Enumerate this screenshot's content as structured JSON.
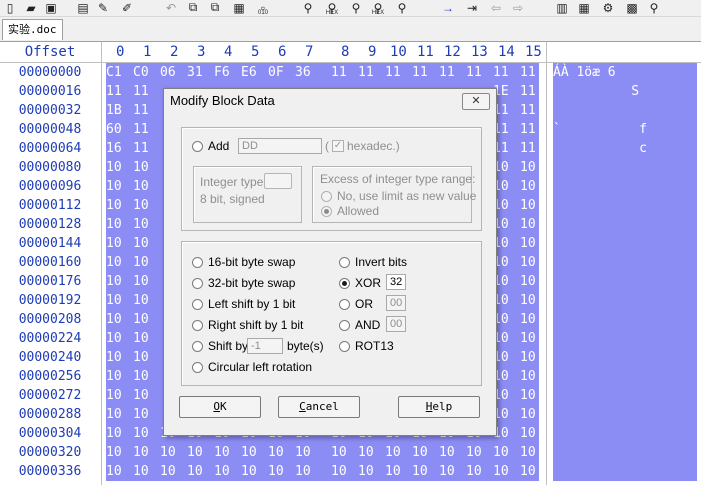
{
  "toolbar": {
    "icons": [
      "new-file-icon",
      "open-icon",
      "save-icon",
      "properties-icon",
      "edit-icon",
      "undo-icon",
      "copy-icon",
      "copy-block-icon",
      "paste-icon",
      "zero-one-icon",
      "find-icon",
      "find-hex-icon",
      "replace-hex-icon",
      "find-next-icon",
      "goto-icon",
      "goto-offset-icon",
      "back-icon",
      "forward-icon",
      "disk-icon",
      "ram-icon",
      "tools-icon",
      "calculator-icon",
      "magnifier-icon"
    ],
    "hex_glyph_labels": [
      "HEX",
      "HEX"
    ],
    "binary_glyph_label": "010"
  },
  "tab": {
    "label": "实验.doc"
  },
  "editor": {
    "offset_header": "Offset",
    "column_headers": [
      "0",
      "1",
      "2",
      "3",
      "4",
      "5",
      "6",
      "7",
      "8",
      "9",
      "10",
      "11",
      "12",
      "13",
      "14",
      "15"
    ],
    "rows": [
      {
        "offset": "00000000",
        "bytes": [
          "C1",
          "C0",
          "06",
          "31",
          "F6",
          "E6",
          "0F",
          "36",
          "11",
          "11",
          "11",
          "11",
          "11",
          "11",
          "11",
          "11"
        ],
        "text": "ÁÀ 1öæ 6"
      },
      {
        "offset": "00000016",
        "bytes": [
          "11",
          "11",
          "",
          "",
          "",
          "",
          "",
          "",
          "",
          "",
          "",
          "",
          "",
          "",
          "1E",
          "11"
        ],
        "text": "          S"
      },
      {
        "offset": "00000032",
        "bytes": [
          "1B",
          "11",
          "",
          "",
          "",
          "",
          "",
          "",
          "",
          "",
          "",
          "",
          "",
          "",
          "11",
          "11"
        ],
        "text": ""
      },
      {
        "offset": "00000048",
        "bytes": [
          "60",
          "11",
          "",
          "",
          "",
          "",
          "",
          "",
          "",
          "",
          "",
          "",
          "",
          "",
          "11",
          "11"
        ],
        "text": "`          f"
      },
      {
        "offset": "00000064",
        "bytes": [
          "16",
          "11",
          "",
          "",
          "",
          "",
          "",
          "",
          "",
          "",
          "",
          "",
          "",
          "",
          "11",
          "11"
        ],
        "text": "           c"
      },
      {
        "offset": "00000080",
        "bytes": [
          "10",
          "10",
          "",
          "",
          "",
          "",
          "",
          "",
          "",
          "",
          "",
          "",
          "",
          "",
          "10",
          "10"
        ],
        "text": ""
      },
      {
        "offset": "00000096",
        "bytes": [
          "10",
          "10",
          "",
          "",
          "",
          "",
          "",
          "",
          "",
          "",
          "",
          "",
          "",
          "",
          "10",
          "10"
        ],
        "text": ""
      },
      {
        "offset": "00000112",
        "bytes": [
          "10",
          "10",
          "",
          "",
          "",
          "",
          "",
          "",
          "",
          "",
          "",
          "",
          "",
          "",
          "10",
          "10"
        ],
        "text": ""
      },
      {
        "offset": "00000128",
        "bytes": [
          "10",
          "10",
          "",
          "",
          "",
          "",
          "",
          "",
          "",
          "",
          "",
          "",
          "",
          "",
          "10",
          "10"
        ],
        "text": ""
      },
      {
        "offset": "00000144",
        "bytes": [
          "10",
          "10",
          "",
          "",
          "",
          "",
          "",
          "",
          "",
          "",
          "",
          "",
          "",
          "",
          "10",
          "10"
        ],
        "text": ""
      },
      {
        "offset": "00000160",
        "bytes": [
          "10",
          "10",
          "",
          "",
          "",
          "",
          "",
          "",
          "",
          "",
          "",
          "",
          "",
          "",
          "10",
          "10"
        ],
        "text": ""
      },
      {
        "offset": "00000176",
        "bytes": [
          "10",
          "10",
          "",
          "",
          "",
          "",
          "",
          "",
          "",
          "",
          "",
          "",
          "",
          "",
          "10",
          "10"
        ],
        "text": ""
      },
      {
        "offset": "00000192",
        "bytes": [
          "10",
          "10",
          "",
          "",
          "",
          "",
          "",
          "",
          "",
          "",
          "",
          "",
          "",
          "",
          "10",
          "10"
        ],
        "text": ""
      },
      {
        "offset": "00000208",
        "bytes": [
          "10",
          "10",
          "",
          "",
          "",
          "",
          "",
          "",
          "",
          "",
          "",
          "",
          "",
          "",
          "10",
          "10"
        ],
        "text": ""
      },
      {
        "offset": "00000224",
        "bytes": [
          "10",
          "10",
          "",
          "",
          "",
          "",
          "",
          "",
          "",
          "",
          "",
          "",
          "",
          "",
          "10",
          "10"
        ],
        "text": ""
      },
      {
        "offset": "00000240",
        "bytes": [
          "10",
          "10",
          "",
          "",
          "",
          "",
          "",
          "",
          "",
          "",
          "",
          "",
          "",
          "",
          "10",
          "10"
        ],
        "text": ""
      },
      {
        "offset": "00000256",
        "bytes": [
          "10",
          "10",
          "",
          "",
          "",
          "",
          "",
          "",
          "",
          "",
          "",
          "",
          "",
          "",
          "10",
          "10"
        ],
        "text": ""
      },
      {
        "offset": "00000272",
        "bytes": [
          "10",
          "10",
          "",
          "",
          "",
          "",
          "",
          "",
          "",
          "",
          "",
          "",
          "",
          "",
          "10",
          "10"
        ],
        "text": ""
      },
      {
        "offset": "00000288",
        "bytes": [
          "10",
          "10",
          "",
          "",
          "",
          "",
          "",
          "",
          "",
          "",
          "",
          "",
          "",
          "",
          "10",
          "10"
        ],
        "text": ""
      },
      {
        "offset": "00000304",
        "bytes": [
          "10",
          "10",
          "10",
          "10",
          "10",
          "10",
          "10",
          "10",
          "10",
          "10",
          "10",
          "10",
          "10",
          "10",
          "10",
          "10"
        ],
        "text": ""
      },
      {
        "offset": "00000320",
        "bytes": [
          "10",
          "10",
          "10",
          "10",
          "10",
          "10",
          "10",
          "10",
          "10",
          "10",
          "10",
          "10",
          "10",
          "10",
          "10",
          "10"
        ],
        "text": ""
      },
      {
        "offset": "00000336",
        "bytes": [
          "10",
          "10",
          "10",
          "10",
          "10",
          "10",
          "10",
          "10",
          "10",
          "10",
          "10",
          "10",
          "10",
          "10",
          "10",
          "10"
        ],
        "text": ""
      }
    ]
  },
  "dialog": {
    "title": "Modify Block Data",
    "close_label": "✕",
    "add": {
      "label": "Add",
      "value": "DD",
      "paren_open": "(",
      "hexadec_label": "hexadec.)",
      "hexadec_checked": true,
      "check_glyph": "✓"
    },
    "integer_type": {
      "label": "Integer type:",
      "value": "8 bit, signed"
    },
    "excess": {
      "label": "Excess of integer type range:",
      "option_no": "No, use limit as new value",
      "option_allowed": "Allowed",
      "selected": "allowed"
    },
    "operations": {
      "selected": "xor",
      "swap16": "16-bit byte swap",
      "swap32": "32-bit byte swap",
      "left_shift": "Left shift by 1 bit",
      "right_shift": "Right shift by 1 bit",
      "shift_by": "Shift by",
      "shift_value": "-1",
      "shift_unit": "byte(s)",
      "circular": "Circular left rotation",
      "invert": "Invert bits",
      "xor": "XOR",
      "xor_value": "32",
      "or": "OR",
      "or_value": "00",
      "and": "AND",
      "and_value": "00",
      "rot13": "ROT13"
    },
    "buttons": {
      "ok_u": "O",
      "ok_rest": "K",
      "cancel_u": "C",
      "cancel_rest": "ancel",
      "help_u": "H",
      "help_rest": "elp"
    }
  },
  "colors": {
    "selection": "#8c8cf5",
    "offset_text": "#1e3cb4",
    "dialog_bg": "#f0f0f0"
  }
}
